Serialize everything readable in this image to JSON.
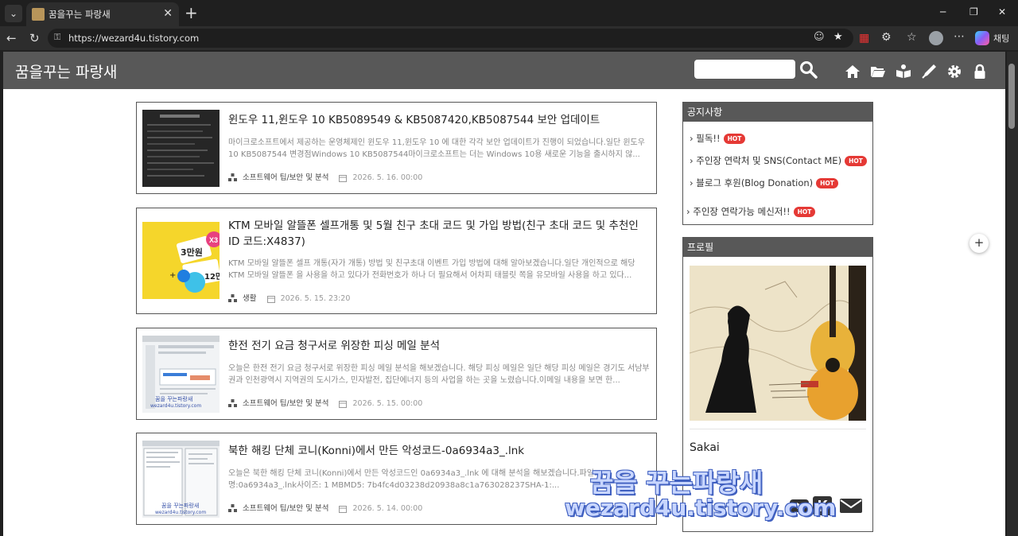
{
  "browser": {
    "tab_title": "꿈을꾸는 파랑새",
    "url": "https://wezard4u.tistory.com",
    "chat_label": "채팅"
  },
  "blog": {
    "title": "꿈을꾸는 파랑새",
    "search_placeholder": ""
  },
  "posts": [
    {
      "title": "윈도우 11,윈도우 10 KB5089549 & KB5087420,KB5087544 보안 업데이트",
      "excerpt": "마이크로소프트에서 제공하는 운영체제인 윈도우 11,윈도우 10 에 대한 각각 보안 업데이트가 진행이 되었습니다.일단 윈도우 10 KB5087544 변경점Windows 10 KB5087544마이크로소프트는 더는 Windows 10용 새로운 기능을 출시하지 않...",
      "category": "소프트웨어 팁/보안 및 분석",
      "date": "2026. 5. 16. 00:00"
    },
    {
      "title": "KTM 모바일 알뜰폰 셀프개통 및 5월 친구 초대 코드 및 가입 방법(친구 초대 코드 및 추천인ID 코드:X4837)",
      "excerpt": "KTM 모바일 알뜰폰 셀프 개통(자가 개통) 방법 및 친구초대 이벤트 가입 방법에 대해 알아보겠습니다.일단 개인적으로 해당 KTM 모바일 알뜰폰 을 사용을 하고 있다가 전화번호가 하나 더 필요해서 어차피 태블릿 쪽을 유모바일 사용을 하고 있다...",
      "category": "생활",
      "date": "2026. 5. 15. 23:20"
    },
    {
      "title": "한전 전기 요금 청구서로 위장한 피싱 메일 분석",
      "excerpt": "오늘은 한전 전기 요금 청구서로 위장한 피싱 메일 분석을 해보겠습니다. 해당 피싱 메일은 일단 해당 피싱 메일은 경기도 서남부권과 인천광역시 지역권의 도시가스, 민자발전, 집단에너지 등의 사업을 하는 곳을 노렸습니다.이메일 내용을 보면 한...",
      "category": "소프트웨어 팁/보안 및 분석",
      "date": "2026. 5. 15. 00:00"
    },
    {
      "title": "북한 해킹 단체 코니(Konni)에서 만든 악성코드-0a6934a3_.lnk",
      "excerpt": "오늘은 북한 해킹 단체 코니(Konni)에서 만든 악성코드인 0a6934a3_.lnk 에 대해 분석을 해보겠습니다.파일명:0a6934a3_.lnk사이즈: 1 MBMD5: 7b4fc4d03238d20938a8c1a763028237SHA-1:...",
      "category": "소프트웨어 팁/보안 및 분석",
      "date": "2026. 5. 14. 00:00"
    }
  ],
  "thumb_texts": {
    "ktm_x3": "X3",
    "ktm_30k": "3만원",
    "ktm_12": "12만",
    "wm_a": "꿈을 꾸는파랑새",
    "wm_b": "wezard4u.tistory.com"
  },
  "notice": {
    "heading": "공지사항",
    "hot_badge": "HOT",
    "items": [
      "필독!!",
      "주인장 연락처 및 SNS(Contact ME)",
      "블로그 후원(Blog Donation)",
      "주인장 연락가능 메신저!!"
    ]
  },
  "profile": {
    "heading": "프로필",
    "name": "Sakai"
  },
  "watermark": {
    "line1": "꿈을 꾸는파랑새",
    "line2": "wezard4u.tistory.com"
  }
}
